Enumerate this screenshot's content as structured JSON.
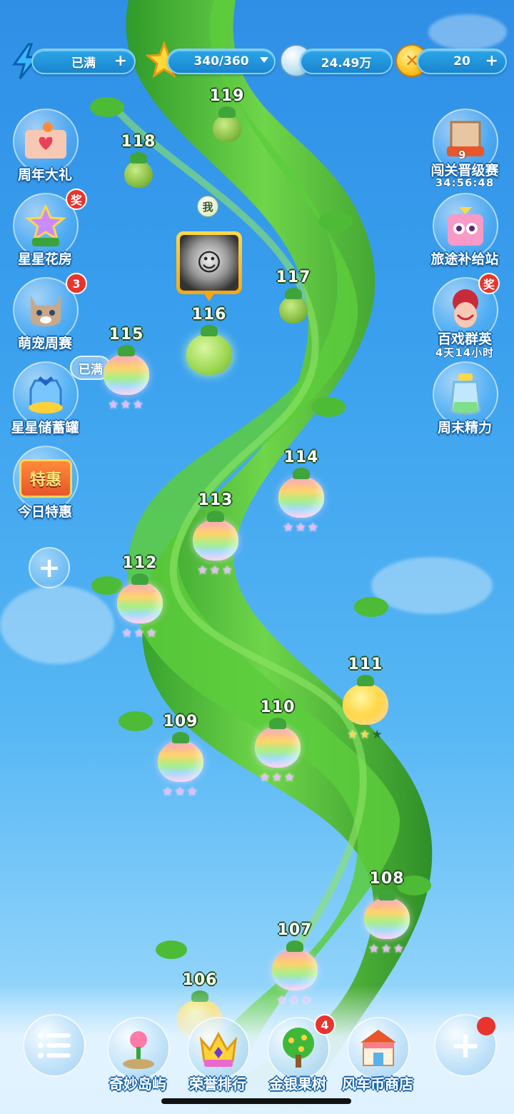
{
  "topbar": {
    "energy": {
      "value": "已满",
      "icon": "lightning-icon"
    },
    "stars": {
      "value": "340/360",
      "icon": "star-icon"
    },
    "bubbles": {
      "value": "24.49万",
      "icon": "bubble-icon"
    },
    "coins": {
      "value": "20",
      "icon": "coin-icon"
    }
  },
  "left_side": [
    {
      "label": "周年大礼",
      "icon": "gift-box-icon"
    },
    {
      "label": "星星花房",
      "icon": "flower-house-icon",
      "badge": "奖"
    },
    {
      "label": "萌宠周赛",
      "icon": "cat-icon",
      "badge": "3"
    },
    {
      "label": "星星储蓄罐",
      "icon": "savings-jar-icon",
      "tag": "已满"
    },
    {
      "label": "今日特惠",
      "icon": "special-offer-icon",
      "sign": "特惠"
    }
  ],
  "right_side": [
    {
      "label": "闯关晋级赛",
      "icon": "trophy-badge-icon",
      "level": "9",
      "sub": "34:56:48"
    },
    {
      "label": "旅途补给站",
      "icon": "owl-box-icon"
    },
    {
      "label": "百戏群英",
      "icon": "opera-mask-icon",
      "badge": "奖",
      "sub": "4天14小时"
    },
    {
      "label": "周末精力",
      "icon": "energy-bottle-icon"
    }
  ],
  "me_tag": "我",
  "levels": [
    {
      "num": "119",
      "kind": "locked",
      "stars": 0
    },
    {
      "num": "118",
      "kind": "locked",
      "stars": 0
    },
    {
      "num": "117",
      "kind": "locked",
      "stars": 0
    },
    {
      "num": "116",
      "kind": "current",
      "stars": 0
    },
    {
      "num": "115",
      "kind": "rainbow",
      "stars": 3
    },
    {
      "num": "114",
      "kind": "rainbow",
      "stars": 3
    },
    {
      "num": "113",
      "kind": "rainbow",
      "stars": 3
    },
    {
      "num": "112",
      "kind": "rainbow",
      "stars": 3
    },
    {
      "num": "111",
      "kind": "gold",
      "stars": 2
    },
    {
      "num": "110",
      "kind": "rainbow",
      "stars": 3
    },
    {
      "num": "109",
      "kind": "rainbow",
      "stars": 3
    },
    {
      "num": "108",
      "kind": "rainbow",
      "stars": 3
    },
    {
      "num": "107",
      "kind": "rainbow",
      "stars": 3
    },
    {
      "num": "106",
      "kind": "gold",
      "stars": 0
    }
  ],
  "dock": [
    {
      "label": "",
      "icon": "menu-list-icon"
    },
    {
      "label": "奇妙岛屿",
      "icon": "island-flower-icon"
    },
    {
      "label": "荣誉排行",
      "icon": "crown-icon"
    },
    {
      "label": "金银果树",
      "icon": "fruit-tree-icon",
      "badge": "4"
    },
    {
      "label": "风车币商店",
      "icon": "shop-icon"
    },
    {
      "label": "",
      "icon": "plus-icon"
    }
  ],
  "colors": {
    "sky_top": "#2f8fe6",
    "stalk": "#4fc23a",
    "badge_red": "#e8342c",
    "star_gold": "#ffd84a"
  }
}
